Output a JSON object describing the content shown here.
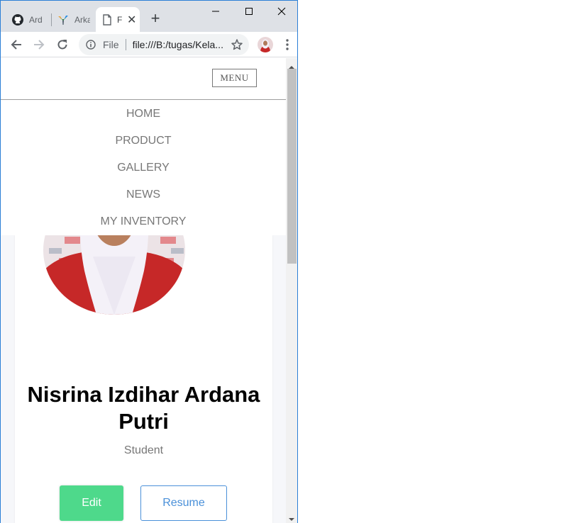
{
  "browser": {
    "tabs": [
      {
        "title": "Ard",
        "icon": "github-icon",
        "active": false
      },
      {
        "title": "Arka",
        "icon": "bird-icon",
        "active": false
      },
      {
        "title": "F",
        "icon": "file-icon",
        "active": true
      }
    ],
    "new_tab_label": "+",
    "close_tab_label": "✕",
    "window_controls": {
      "minimize": "minimize-icon",
      "maximize": "maximize-icon",
      "close": "close-icon"
    },
    "address": {
      "scheme": "File",
      "url": "file:///B:/tugas/Kela..."
    },
    "accent": "#2b7fd6"
  },
  "site": {
    "menu_label": "MENU",
    "nav": [
      "HOME",
      "PRODUCT",
      "GALLERY",
      "NEWS",
      "MY INVENTORY"
    ]
  },
  "profile": {
    "name": "Nisrina Izdihar Ardana Putri",
    "role": "Student",
    "edit_label": "Edit",
    "resume_label": "Resume",
    "colors": {
      "edit": "#4ed98b",
      "resume": "#4a90d9"
    }
  }
}
